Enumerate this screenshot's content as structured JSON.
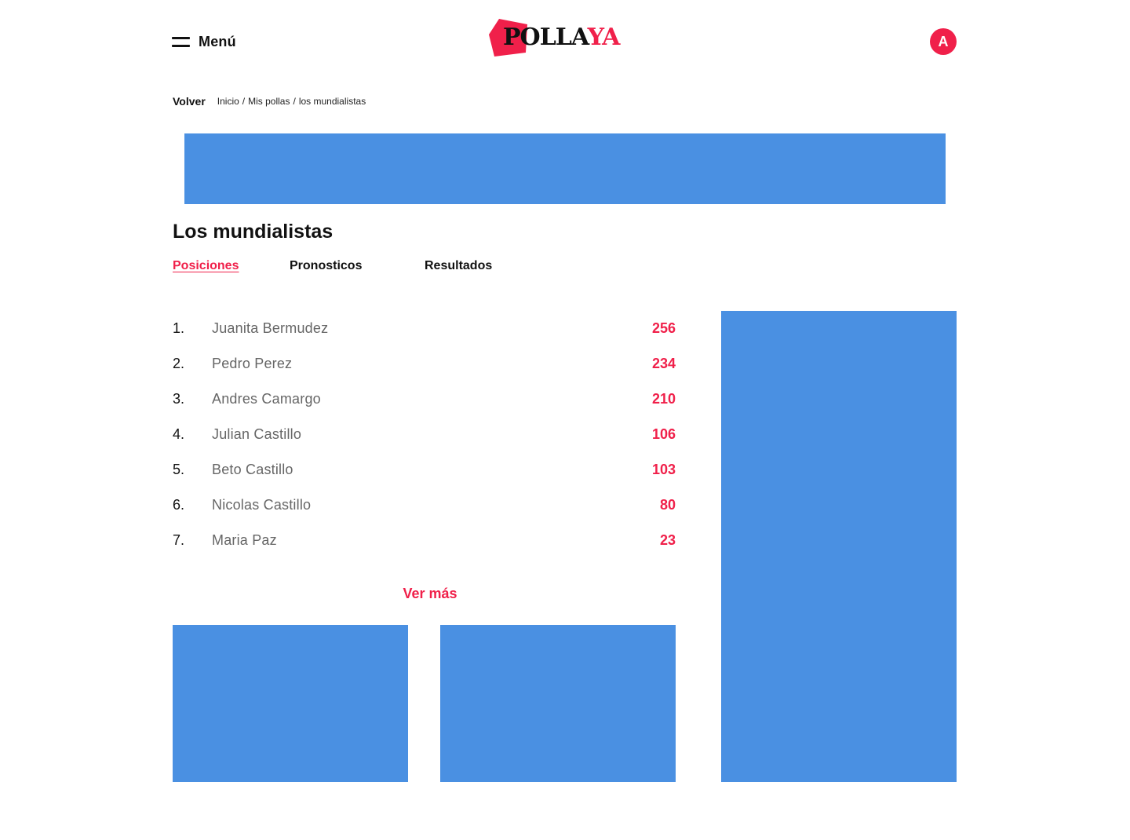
{
  "header": {
    "menu_label": "Menú",
    "logo": {
      "text_dark": "POLLA",
      "text_red": "YA"
    },
    "avatar_initial": "A"
  },
  "breadcrumb": {
    "back_label": "Volver",
    "items": [
      "Inicio",
      "Mis pollas",
      "los mundialistas"
    ],
    "separator": "/"
  },
  "page": {
    "title": "Los mundialistas"
  },
  "tabs": [
    {
      "label": "Posiciones",
      "active": true
    },
    {
      "label": "Pronosticos",
      "active": false
    },
    {
      "label": "Resultados",
      "active": false
    }
  ],
  "ranking": [
    {
      "position": "1.",
      "name": "Juanita Bermudez",
      "points": "256"
    },
    {
      "position": "2.",
      "name": "Pedro Perez",
      "points": "234"
    },
    {
      "position": "3.",
      "name": "Andres Camargo",
      "points": "210"
    },
    {
      "position": "4.",
      "name": "Julian Castillo",
      "points": "106"
    },
    {
      "position": "5.",
      "name": "Beto Castillo",
      "points": "103"
    },
    {
      "position": "6.",
      "name": "Nicolas Castillo",
      "points": "80"
    },
    {
      "position": "7.",
      "name": "Maria Paz",
      "points": "23"
    }
  ],
  "see_more_label": "Ver más",
  "colors": {
    "accent": "#f0204a",
    "ad_placeholder": "#4a90e2",
    "text": "#111111",
    "muted_text": "#666666"
  },
  "icons": {
    "menu": "hamburger-icon"
  }
}
